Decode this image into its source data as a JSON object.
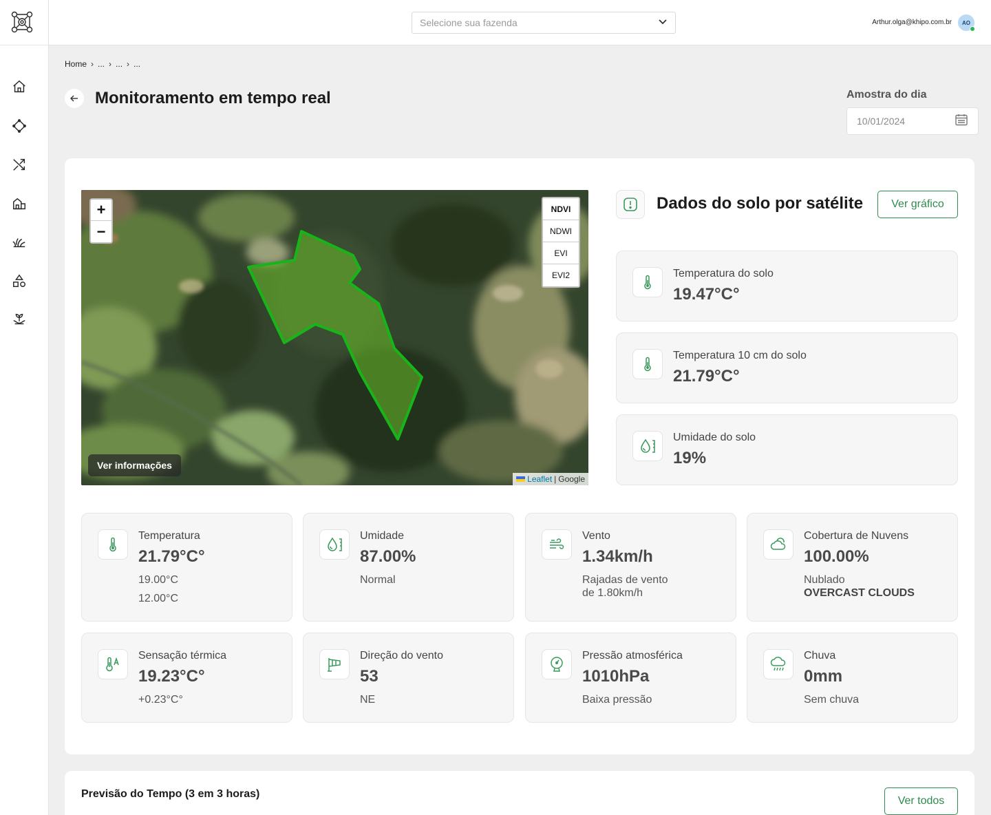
{
  "header": {
    "farm_select_placeholder": "Selecione sua fazenda",
    "user_email": "Arthur.olga@khipo.com.br",
    "avatar_initials": "AO"
  },
  "sidebar": {
    "items": [
      {
        "icon": "home-icon"
      },
      {
        "icon": "diamond-nodes-icon"
      },
      {
        "icon": "shuffle-icon"
      },
      {
        "icon": "farm-building-icon"
      },
      {
        "icon": "grass-icon"
      },
      {
        "icon": "shapes-icon"
      },
      {
        "icon": "plant-hand-icon"
      }
    ]
  },
  "breadcrumb": [
    "Home",
    "...",
    "...",
    "..."
  ],
  "page": {
    "title": "Monitoramento em tempo real",
    "date_label": "Amostra do dia",
    "date_value": "10/01/2024"
  },
  "map": {
    "layers": [
      "NDVI",
      "NDWI",
      "EVI",
      "EVI2"
    ],
    "active_layer": "NDVI",
    "zoom_in": "+",
    "zoom_out": "−",
    "info_button": "Ver informações",
    "attribution_link": "Leaflet",
    "attribution_sep": "|",
    "attribution_source": "Google"
  },
  "soil": {
    "title": "Dados do solo por satélite",
    "button": "Ver gráfico",
    "cards": [
      {
        "label": "Temperatura do solo",
        "value": "19.47°C°",
        "icon": "thermometer-icon"
      },
      {
        "label": "Temperatura 10 cm do solo",
        "value": "21.79°C°",
        "icon": "thermometer-icon"
      },
      {
        "label": "Umidade do solo",
        "value": "19%",
        "icon": "droplet-gauge-icon"
      }
    ]
  },
  "weather": {
    "cards": [
      {
        "label": "Temperatura",
        "value": "21.79°C°",
        "sub1": "19.00°C",
        "sub2": "12.00°C",
        "icon": "thermometer-icon"
      },
      {
        "label": "Umidade",
        "value": "87.00%",
        "sub1": "Normal",
        "icon": "droplet-gauge-icon"
      },
      {
        "label": "Vento",
        "value": "1.34km/h",
        "sub1": "Rajadas de vento",
        "sub2": "de 1.80km/h",
        "icon": "wind-icon"
      },
      {
        "label": "Cobertura de Nuvens",
        "value": "100.00%",
        "sub1": "Nublado",
        "sub2": "OVERCAST CLOUDS",
        "icon": "cloud-icon"
      },
      {
        "label": "Sensação térmica",
        "value": "19.23°C°",
        "sub1": "+0.23°C°",
        "icon": "feels-like-icon"
      },
      {
        "label": "Direção do vento",
        "value": "53",
        "sub1": "NE",
        "icon": "windsock-icon"
      },
      {
        "label": "Pressão atmosférica",
        "value": "1010hPa",
        "sub1": "Baixa pressão",
        "icon": "pressure-gauge-icon"
      },
      {
        "label": "Chuva",
        "value": "0mm",
        "sub1": "Sem chuva",
        "icon": "rain-icon"
      }
    ]
  },
  "forecast": {
    "title": "Previsão do Tempo (3 em 3 horas)",
    "button": "Ver todos"
  },
  "colors": {
    "accent": "#2f8a4e",
    "icon_green": "#3a9a5c",
    "polygon_fill": "#6bbf2a",
    "polygon_stroke": "#19b31a"
  }
}
